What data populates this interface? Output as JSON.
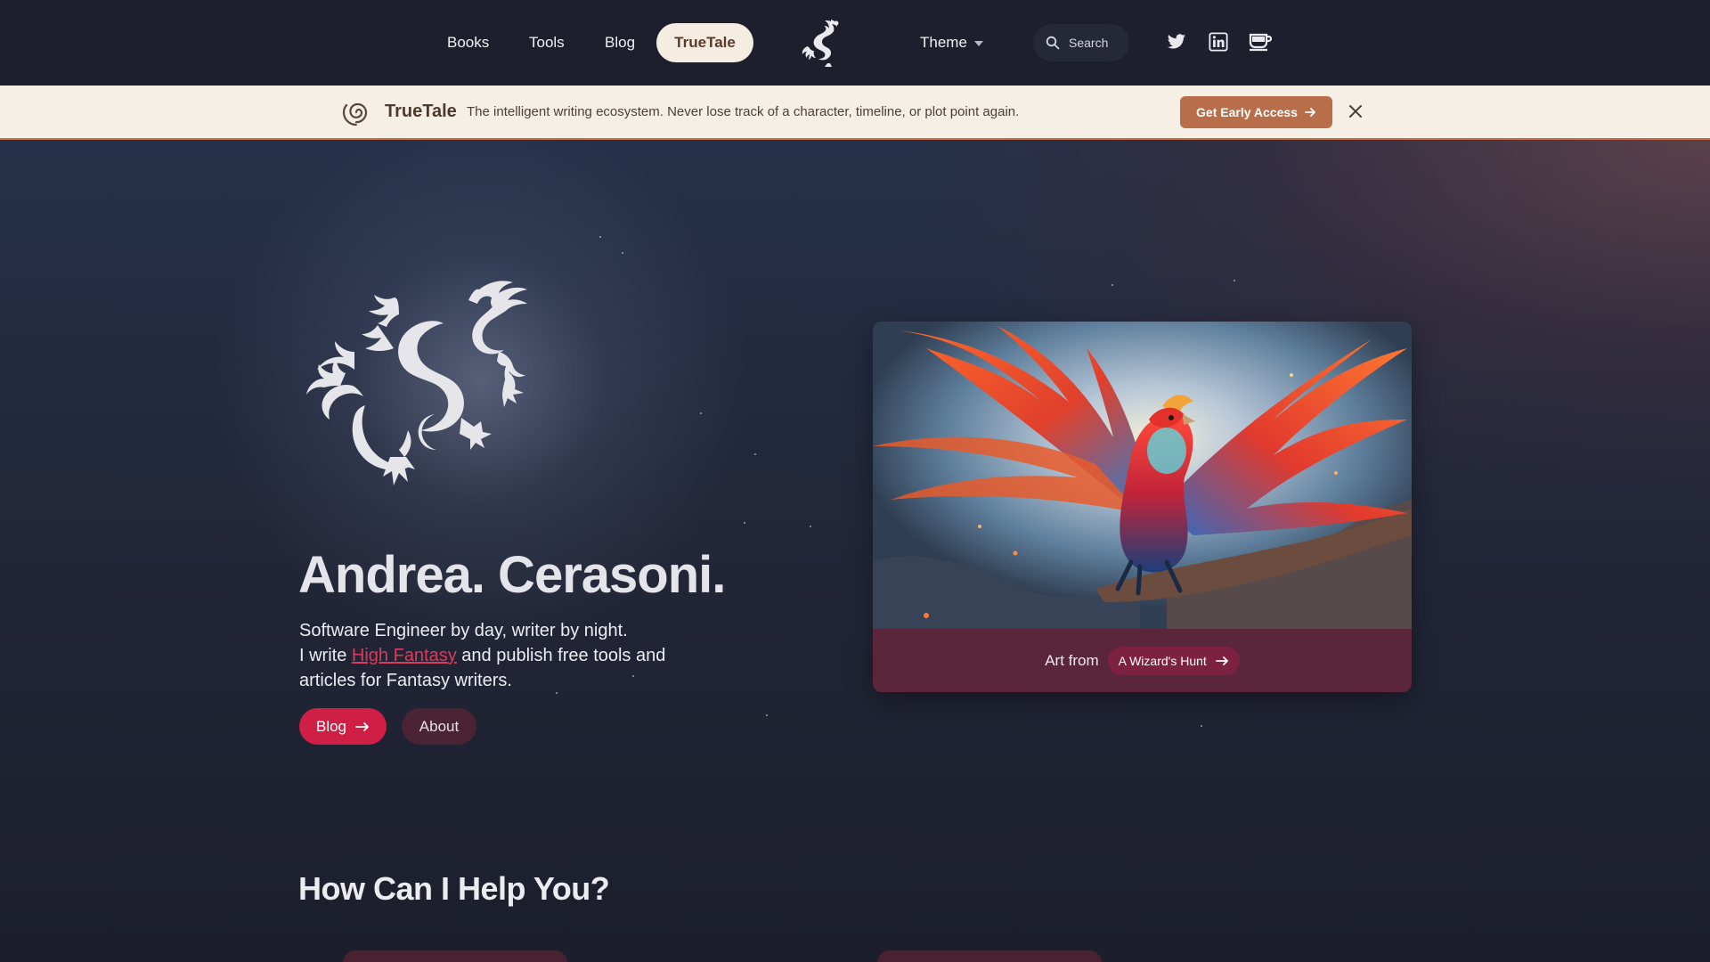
{
  "nav": {
    "items": [
      {
        "label": "Books"
      },
      {
        "label": "Tools"
      },
      {
        "label": "Blog"
      }
    ],
    "highlight_label": "TrueTale",
    "theme_label": "Theme",
    "search_label": "Search",
    "social": [
      "twitter-icon",
      "linkedin-icon",
      "coffee-cup-icon"
    ]
  },
  "banner": {
    "brand": "TrueTale",
    "text": "The intelligent writing ecosystem. Never lose track of a character, timeline, or plot point again.",
    "cta_label": "Get Early Access",
    "accent_color": "#b86e4b"
  },
  "hero": {
    "name": "Andrea. Cerasoni.",
    "line1": "Software Engineer by day, writer by night.",
    "line2_prefix": "I write ",
    "line2_link": "High Fantasy",
    "line2_suffix": " and publish free tools and articles for Fantasy writers.",
    "blog_button": "Blog",
    "about_button": "About",
    "accent_color": "#d01f45"
  },
  "art": {
    "caption": "Art from",
    "link_label": "A Wizard's Hunt",
    "image_icon": "phoenix-artwork"
  },
  "section": {
    "title": "How Can I Help You?"
  }
}
